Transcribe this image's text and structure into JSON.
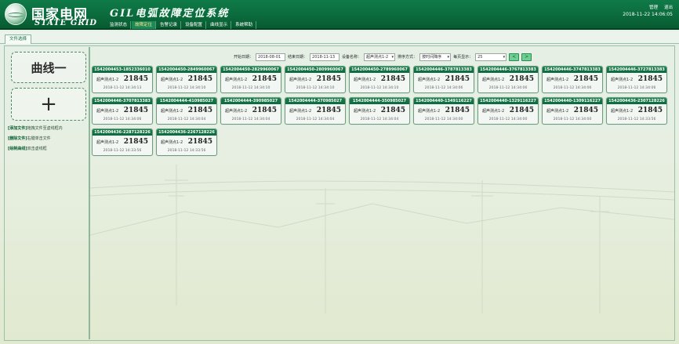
{
  "header": {
    "logo_cn": "国家电网",
    "logo_en": "STATE GRID",
    "app_title": "GIL电弧故障定位系统",
    "nav": [
      "监测状态",
      "故障定位",
      "告警记录",
      "设备配置",
      "曲线显示",
      "系统帮助"
    ],
    "active_nav": 1,
    "user": "管理",
    "logout": "退出",
    "datetime": "2018-11-22 14:06:05"
  },
  "tab": {
    "label": "文件选择"
  },
  "left": {
    "curve_button": "曲线一",
    "add_button": "+",
    "tips": [
      {
        "tag": "[添加文件]",
        "text": "拖拽文件至虚线框内"
      },
      {
        "tag": "[删除文件]",
        "text": "右键单击文件"
      },
      {
        "tag": "[绘制曲线]",
        "text": "双击虚线框"
      }
    ]
  },
  "toolbar": {
    "start_label": "开始日期：",
    "start_value": "2018-08-01",
    "end_label": "结束日期：",
    "end_value": "2018-11-13",
    "device_label": "设备名称：",
    "device_value": "超声测点1-2",
    "sort_label": "排序方式：",
    "sort_value": "按时间降序",
    "page_size_label": "每页显示：",
    "page_size_value": "25",
    "prev": "<",
    "next": ">"
  },
  "cards": [
    {
      "id": "1542004453-1852336010",
      "label": "超声测点1-2",
      "value": "21845",
      "time": "2018-11-12 14:34:13"
    },
    {
      "id": "1542004450-2849960067",
      "label": "超声测点1-2",
      "value": "21845",
      "time": "2018-11-12 14:34:10"
    },
    {
      "id": "1542004450-2829960067",
      "label": "超声测点1-2",
      "value": "21845",
      "time": "2018-11-12 14:34:10"
    },
    {
      "id": "1542004450-2809960067",
      "label": "超声测点1-2",
      "value": "21845",
      "time": "2018-11-12 14:34:10"
    },
    {
      "id": "1542004450-2789960067",
      "label": "超声测点1-2",
      "value": "21845",
      "time": "2018-11-12 14:34:10"
    },
    {
      "id": "1542004446-3787813383",
      "label": "超声测点1-2",
      "value": "21845",
      "time": "2018-11-12 14:34:06"
    },
    {
      "id": "1542004446-3767813383",
      "label": "超声测点1-2",
      "value": "21845",
      "time": "2018-11-12 14:34:06"
    },
    {
      "id": "1542004446-3747813383",
      "label": "超声测点1-2",
      "value": "21845",
      "time": "2018-11-12 14:34:06"
    },
    {
      "id": "1542004446-3727813383",
      "label": "超声测点1-2",
      "value": "21845",
      "time": "2018-11-12 14:34:06"
    },
    {
      "id": "1542004446-3707813383",
      "label": "超声测点1-2",
      "value": "21845",
      "time": "2018-11-12 14:34:06"
    },
    {
      "id": "1542004444-410985027",
      "label": "超声测点1-2",
      "value": "21845",
      "time": "2018-11-12 14:34:04"
    },
    {
      "id": "1542004444-390985027",
      "label": "超声测点1-2",
      "value": "21845",
      "time": "2018-11-12 14:34:04"
    },
    {
      "id": "1542004444-370985027",
      "label": "超声测点1-2",
      "value": "21845",
      "time": "2018-11-12 14:34:04"
    },
    {
      "id": "1542004444-350985027",
      "label": "超声测点1-2",
      "value": "21845",
      "time": "2018-11-12 14:34:04"
    },
    {
      "id": "1542004440-1349116227",
      "label": "超声测点1-2",
      "value": "21845",
      "time": "2018-11-12 14:34:00"
    },
    {
      "id": "1542004440-1329116227",
      "label": "超声测点1-2",
      "value": "21845",
      "time": "2018-11-12 14:34:00"
    },
    {
      "id": "1542004440-1309116227",
      "label": "超声测点1-2",
      "value": "21845",
      "time": "2018-11-12 14:34:00"
    },
    {
      "id": "1542004436-2307128226",
      "label": "超声测点1-2",
      "value": "21845",
      "time": "2018-11-12 14:33:56"
    },
    {
      "id": "1542004436-2287128226",
      "label": "超声测点1-2",
      "value": "21845",
      "time": "2018-11-12 14:33:56"
    },
    {
      "id": "1542004436-2267128226",
      "label": "超声测点1-2",
      "value": "21845",
      "time": "2018-11-12 14:33:56"
    }
  ]
}
